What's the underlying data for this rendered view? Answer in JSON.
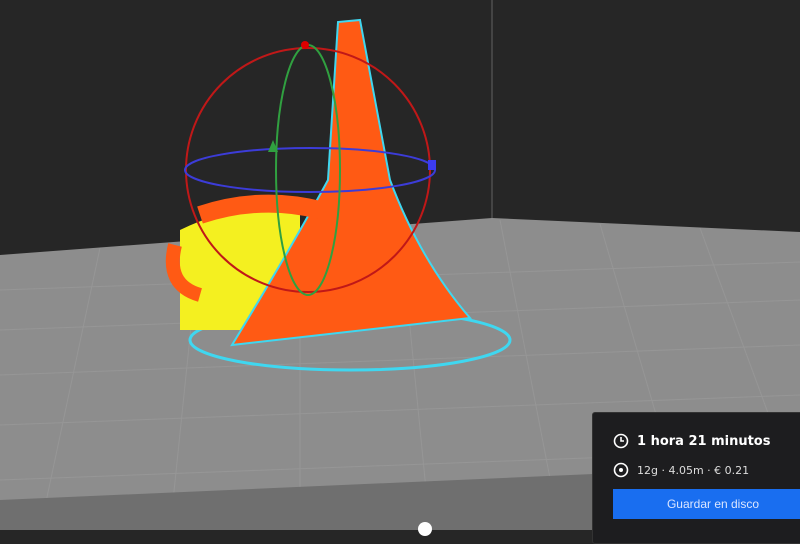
{
  "print_info": {
    "time_estimate": "1 hora 21 minutos",
    "material_estimate": "12g · 4.05m · € 0.21",
    "save_button": "Guardar en disco",
    "clock_icon": "clock-icon",
    "spool_icon": "spool-icon"
  },
  "colors": {
    "accent": "#196ef0",
    "model": "#ff5a14",
    "support": "#f4f020",
    "outline": "#3fd7f0"
  }
}
